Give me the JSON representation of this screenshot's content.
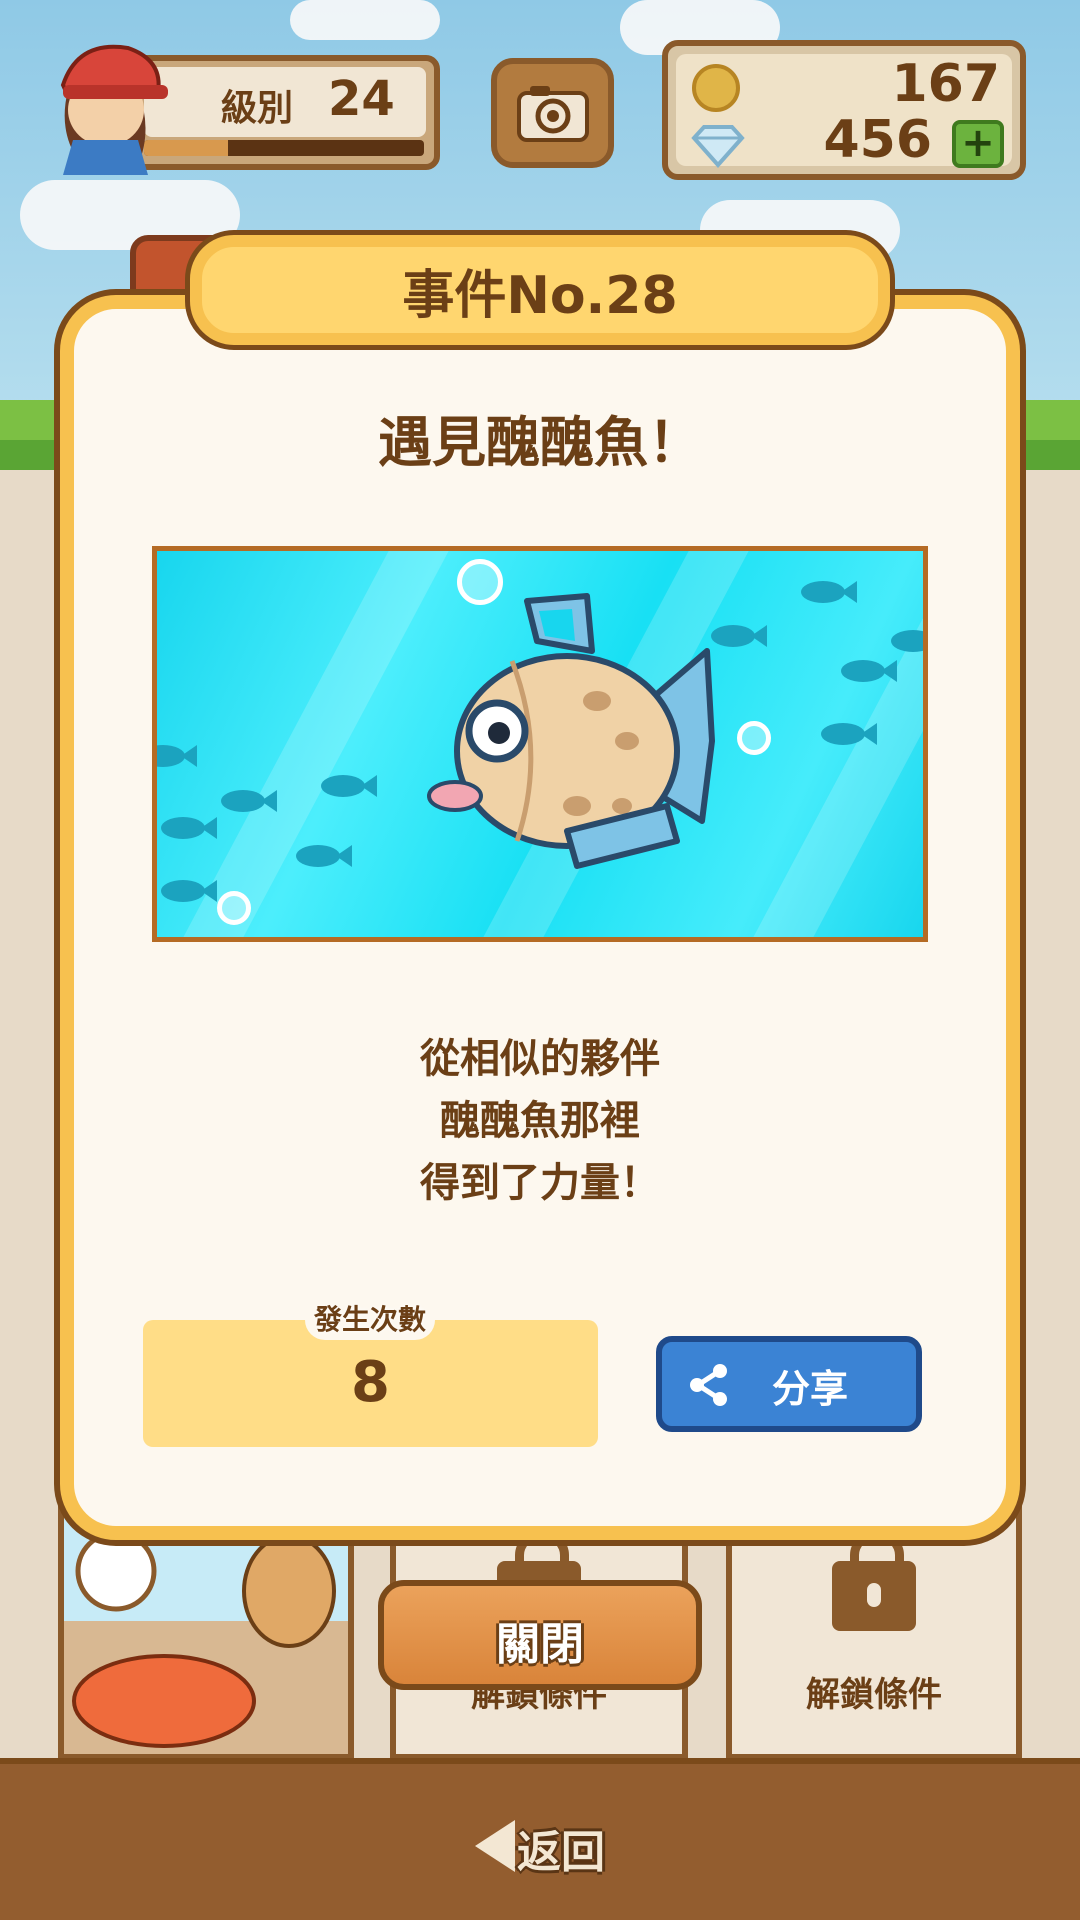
{
  "hud": {
    "level_label": "級別",
    "level": "24",
    "xp_progress": 0.3,
    "coins": "167",
    "gems": "456",
    "plus_label": "+"
  },
  "event": {
    "tab_title": "事件No.28",
    "title": "遇見醜醜魚！",
    "description_lines": [
      "從相似的夥伴",
      "醜醜魚那裡",
      "得到了力量！"
    ],
    "count_label": "發生次數",
    "count": "8",
    "share_label": "分享"
  },
  "cards": {
    "lock_label": "解鎖條件"
  },
  "buttons": {
    "close_label": "關閉",
    "back_label": "返回"
  },
  "colors": {
    "accent_yellow": "#f7c14f",
    "brown": "#6b3f16",
    "share_blue": "#3b83d4",
    "water": "#18d6ee"
  }
}
